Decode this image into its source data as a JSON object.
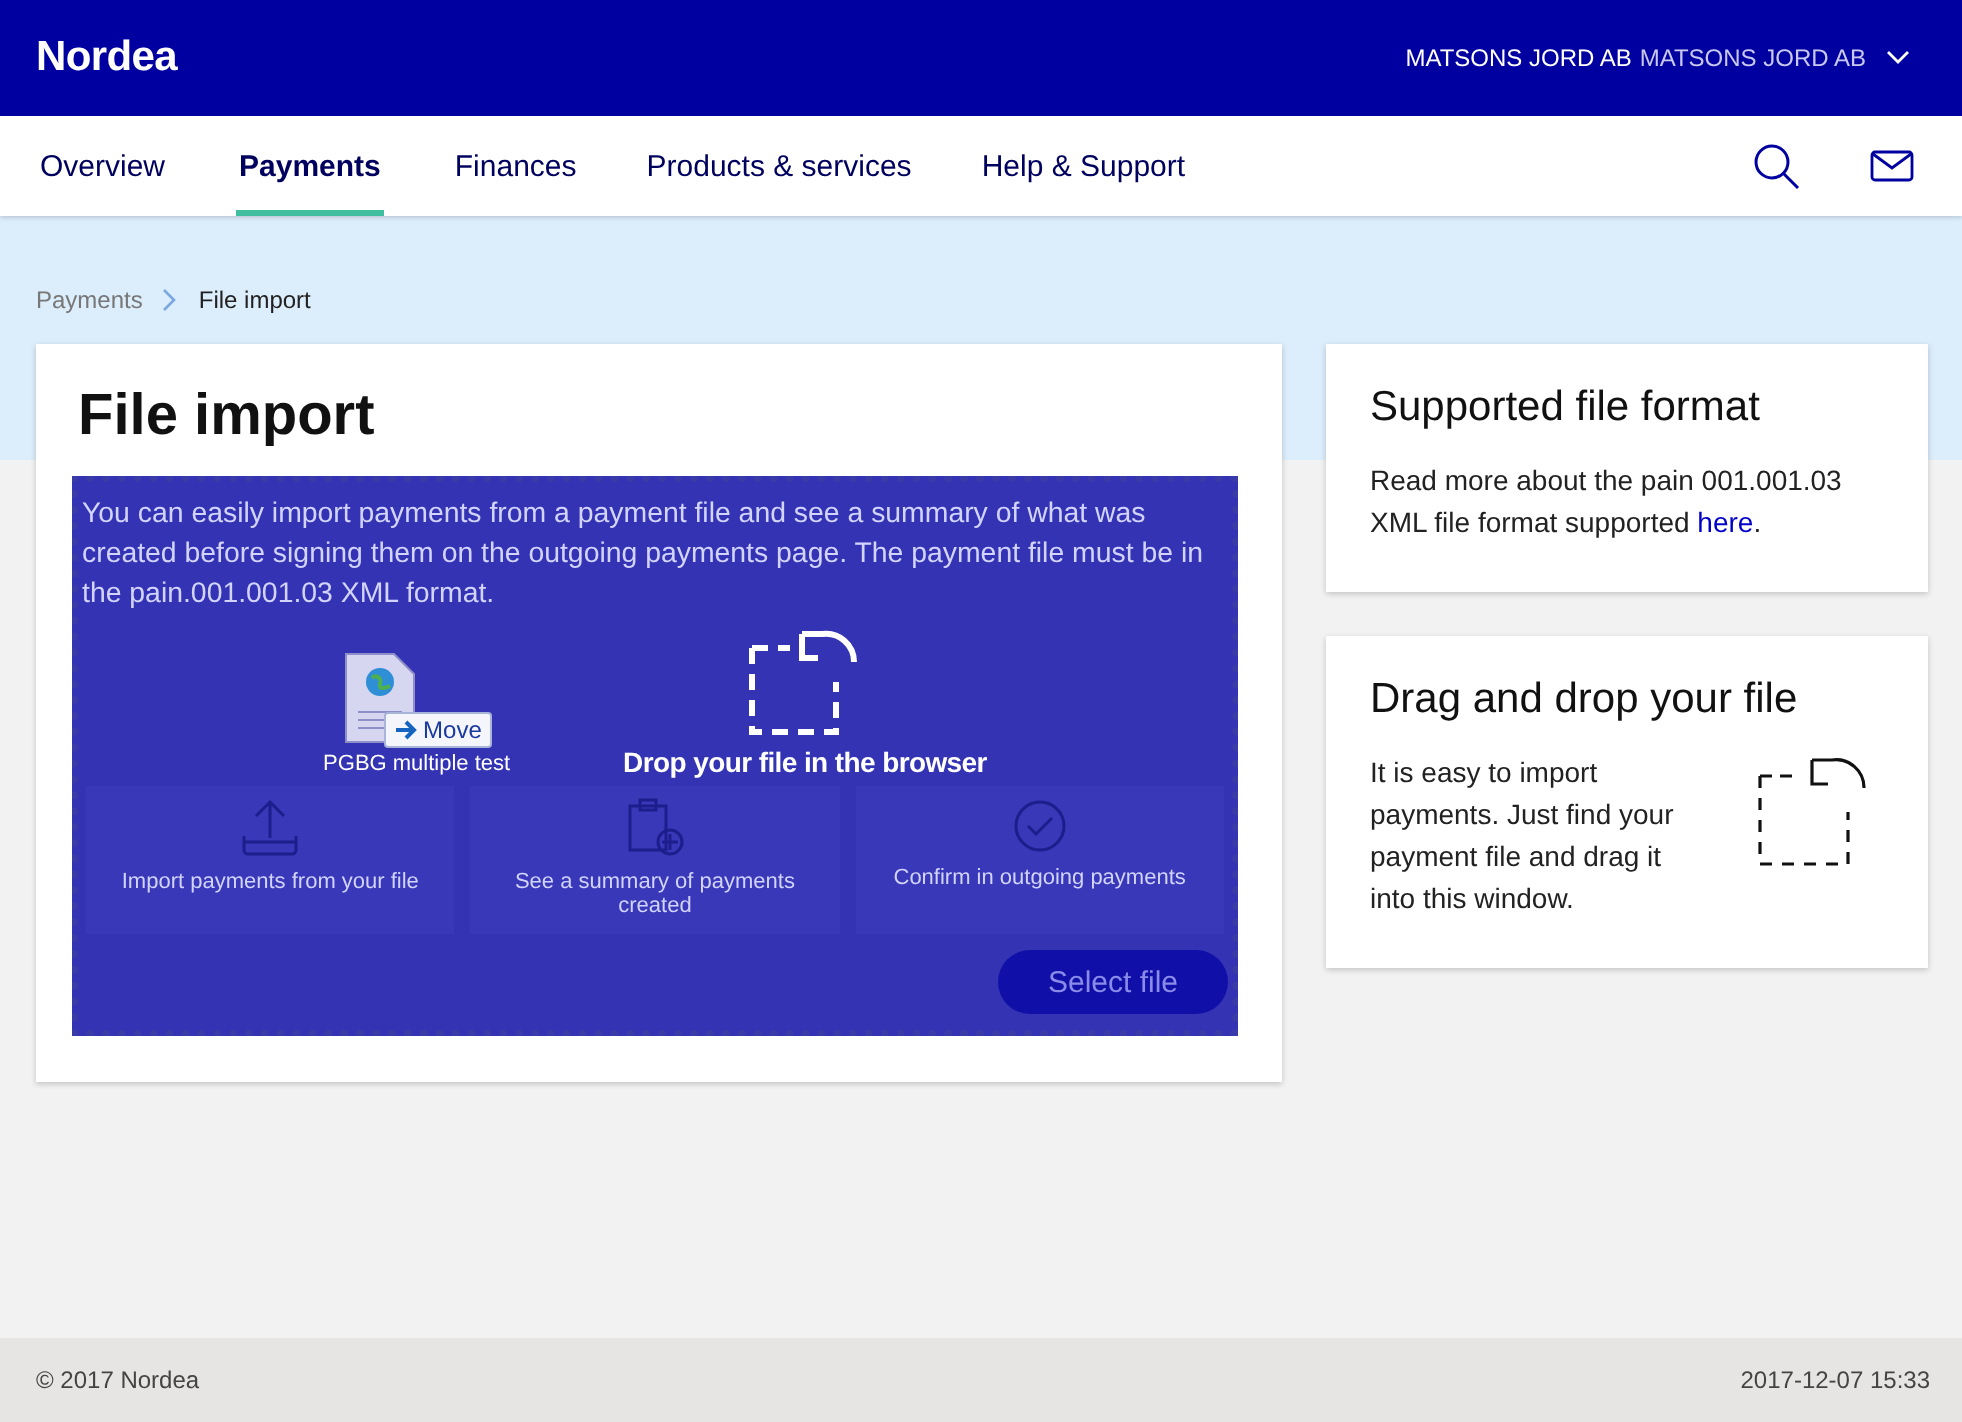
{
  "header": {
    "logo": "Nordea",
    "account_name": "MATSONS JORD AB",
    "account_sub": "MATSONS JORD AB"
  },
  "nav": {
    "tabs": [
      {
        "label": "Overview",
        "selected": false
      },
      {
        "label": "Payments",
        "selected": true
      },
      {
        "label": "Finances",
        "selected": false
      },
      {
        "label": "Products & services",
        "selected": false
      },
      {
        "label": "Help & Support",
        "selected": false
      }
    ]
  },
  "breadcrumb": [
    "Payments",
    "File import"
  ],
  "main": {
    "title": "File import",
    "intro": "You can easily import payments from a payment file and see a summary of what was created before signing them on the outgoing payments page. The payment file must be in the pain.001.001.03 XML format.",
    "steps": [
      {
        "kind": "upload",
        "label": "Import payments from your file"
      },
      {
        "kind": "summary",
        "label": "See a summary of payments created"
      },
      {
        "kind": "confirm",
        "label": "Confirm in outgoing payments"
      }
    ],
    "button": "Select file",
    "drop_message": "Drop your file in the browser",
    "drag_ghost": {
      "file_name": "PGBG multiple test",
      "action": "Move"
    }
  },
  "side_cards": [
    {
      "kind": "link",
      "title": "Supported file format",
      "text": "Read more about the pain 001.001.03 XML file format supported ",
      "link": "here",
      "after": "."
    },
    {
      "kind": "drop",
      "title": "Drag and drop your file",
      "text": "It is easy to import payments. Just find your payment file and drag it into this window."
    }
  ],
  "footer": {
    "copyright": "© 2017 Nordea",
    "timestamp": "2017-12-07 15:33"
  }
}
